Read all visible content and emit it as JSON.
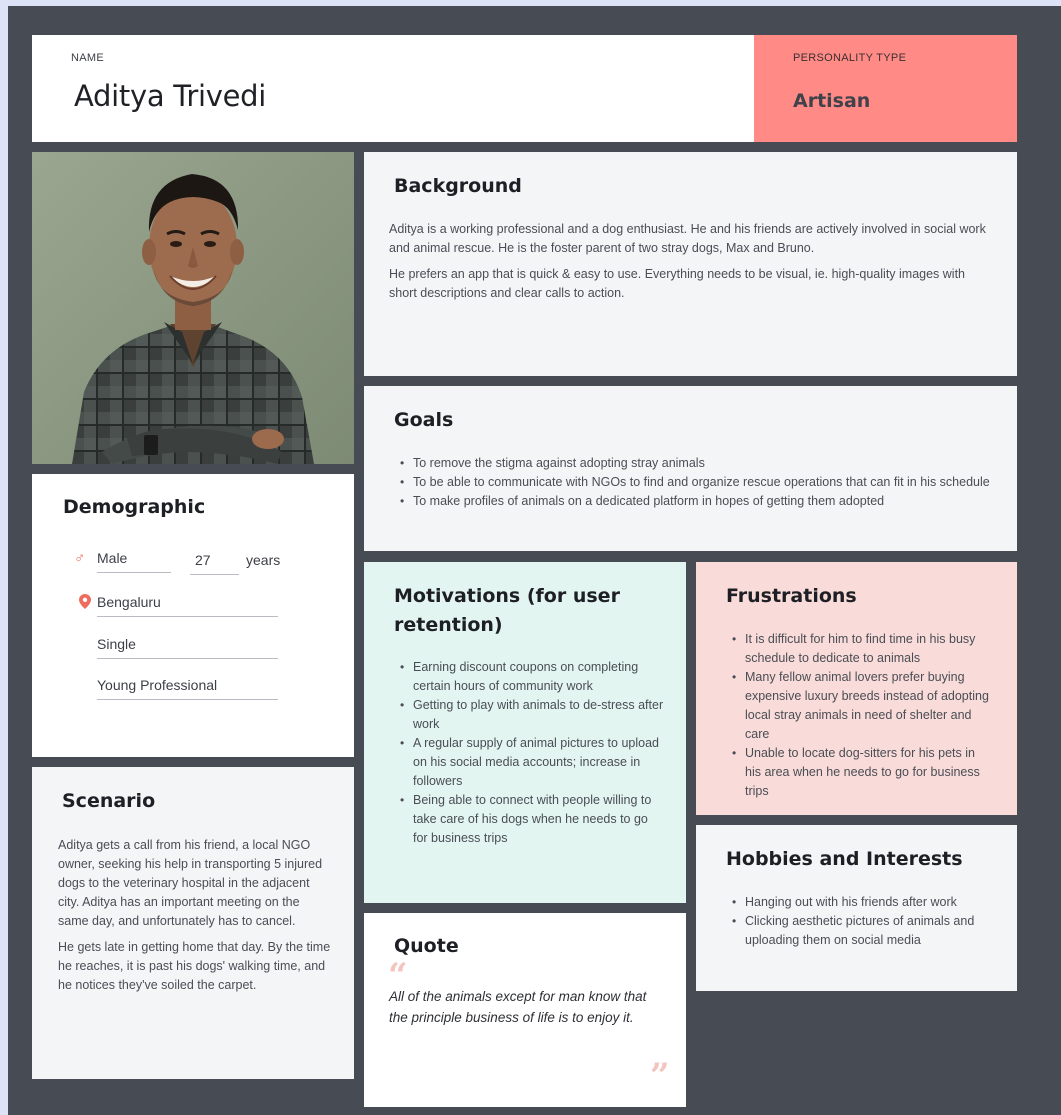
{
  "header": {
    "name_label": "NAME",
    "name": "Aditya Trivedi",
    "personality_label": "PERSONALITY TYPE",
    "personality": "Artisan"
  },
  "background": {
    "title": "Background",
    "paragraphs": [
      "Aditya is a working professional and a dog enthusiast. He and his friends are actively involved in social work and animal rescue. He is the foster parent of two stray dogs, Max and Bruno.",
      "He prefers an app that is quick & easy to use. Everything needs to be visual, ie. high-quality images with short descriptions and clear calls to action."
    ]
  },
  "goals": {
    "title": "Goals",
    "items": [
      "To remove the stigma against adopting stray animals",
      "To be able to communicate with NGOs to find and organize rescue operations that can fit in his schedule",
      "To make profiles of animals on a dedicated platform in hopes of getting them adopted"
    ]
  },
  "demographic": {
    "title": "Demographic",
    "gender": "Male",
    "age": "27",
    "age_unit": "years",
    "location": "Bengaluru",
    "status": "Single",
    "occupation": "Young Professional"
  },
  "motivations": {
    "title": "Motivations (for user retention)",
    "items": [
      "Earning discount coupons on completing certain hours of community work",
      "Getting to play with animals to de-stress after work",
      "A regular supply of animal pictures to upload on his social media accounts; increase in followers",
      "Being able to connect with people willing to take care of his dogs when he needs to go for business trips"
    ]
  },
  "frustrations": {
    "title": "Frustrations",
    "items": [
      "It is difficult for him to find time in his busy schedule to dedicate to animals",
      "Many fellow animal lovers prefer buying expensive luxury breeds instead of adopting local stray animals in need of shelter and care",
      "Unable to locate dog-sitters for his pets in his area when he needs to go for business trips"
    ]
  },
  "scenario": {
    "title": "Scenario",
    "paragraphs": [
      "Aditya gets a call from his friend, a local NGO owner, seeking his help in transporting 5 injured dogs to the veterinary hospital in the adjacent city. Aditya has an important meeting on the same day, and unfortunately has to cancel.",
      "He gets late in getting home that day. By the time he reaches, it is past his dogs' walking time, and he notices they've soiled the carpet."
    ]
  },
  "quote": {
    "title": "Quote",
    "text": "All of the animals except for man know that the principle business of life is to enjoy it."
  },
  "hobbies": {
    "title": "Hobbies and Interests",
    "items": [
      "Hanging out with his friends after work",
      "Clicking aesthetic pictures of animals and uploading them on social media"
    ]
  },
  "colors": {
    "frame": "#474b54",
    "personality_bg": "#ff8a86",
    "motivations_bg": "#e3f5f1",
    "frustrations_bg": "#f9dcd9",
    "icon_accent": "#ef6b5e"
  },
  "icons": [
    "male-icon",
    "location-pin-icon",
    "open-quote-icon",
    "close-quote-icon"
  ]
}
